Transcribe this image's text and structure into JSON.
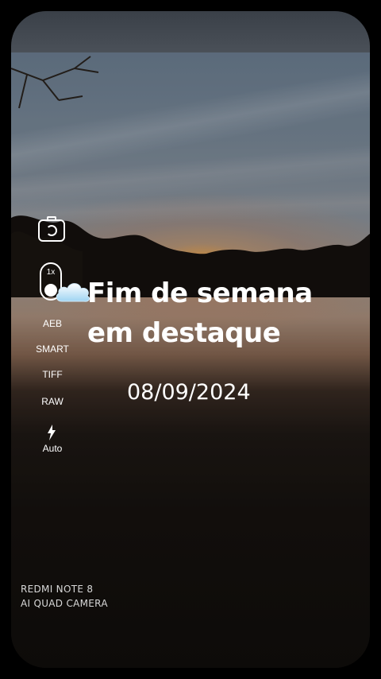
{
  "sidebar": {
    "zoom_label": "1x",
    "modes": [
      "AEB",
      "SMART",
      "TIFF",
      "RAW"
    ],
    "flash_label": "Auto",
    "icons": {
      "camera_switch": "camera-switch-icon",
      "flash": "flash-icon"
    }
  },
  "overlay": {
    "title_line1": "Fim de semana",
    "title_line2": "em destaque",
    "weather_icon": "cloud-icon",
    "date": "08/09/2024"
  },
  "watermark": {
    "line1": "REDMI NOTE 8",
    "line2": "AI QUAD CAMERA"
  }
}
